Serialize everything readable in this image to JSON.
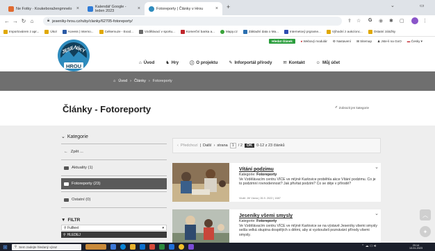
{
  "browser": {
    "tabs": [
      {
        "title": "Ne Fotky · Koukeboražengmnelo",
        "color": "#e06a2f"
      },
      {
        "title": "Kalendář Google - leden 2023",
        "color": "#2e7bd6"
      },
      {
        "title": "Fotoreporty | Články v Hrou",
        "color": "#2e8bbd"
      }
    ],
    "new_tab_label": "+",
    "url": "jeseniky-hrou.cz/ruby/clanky/62705-fotoreporty/",
    "bookmarks": [
      {
        "label": "Importovárem z apr...",
        "color": "#e0a800"
      },
      {
        "label": "Úkol",
        "color": "#e0a800"
      },
      {
        "label": "Aceess | Interno...",
        "color": "#2b5aa5"
      },
      {
        "label": "Celkemuze - Exod...",
        "color": "#e0a800"
      },
      {
        "label": "Vzdělávací v sportu...",
        "color": "#6a6a6a"
      },
      {
        "label": "Komerční banka a...",
        "color": "#c0262b"
      },
      {
        "label": "Mapy.cz",
        "color": "#3aa33a"
      },
      {
        "label": "Základní data o Ma...",
        "color": "#2b6fb0"
      },
      {
        "label": "Internetový prgrame...",
        "color": "#2d4db0"
      },
      {
        "label": "Výhodní z aukcíonc...",
        "color": "#e0a800"
      },
      {
        "label": "Ostatní záložky",
        "color": "#e0a800"
      }
    ]
  },
  "site": {
    "top_links": {
      "hledat": "Hledat článek",
      "ekniha": "Webový modulár",
      "nastaveni": "Nastavení",
      "sitemap": "Sitemap",
      "login": "Jste-li na GoO",
      "lang": "Česky"
    },
    "logo_text": {
      "line1": "JESE",
      "line2": "NÍKY",
      "line3": "HROU"
    },
    "nav": [
      {
        "icon": "home-icon",
        "label": "Úvod"
      },
      {
        "icon": "game-icon",
        "label": "Hry"
      },
      {
        "icon": "info-icon",
        "label": "O projektu"
      },
      {
        "icon": "leaf-icon",
        "label": "Inforportál přírody"
      },
      {
        "icon": "mail-icon",
        "label": "Kontakt"
      },
      {
        "icon": "user-icon",
        "label": "Můj účet"
      }
    ],
    "breadcrumb": [
      "Úvod",
      "Články",
      "Fotoreporty"
    ],
    "page_title": "Články - Fotoreporty",
    "shortlink": "Zobrazit jen kategorie"
  },
  "sidebar": {
    "heading": "Kategorie",
    "back": "Zpět ...",
    "items": [
      {
        "label": "Aktuality (1)",
        "active": false
      },
      {
        "label": "Fotoreporty (23)",
        "active": true
      },
      {
        "label": "Ostatní (0)",
        "active": false
      }
    ],
    "filter_heading": "FILTR",
    "fulltext_label": "Fulltext",
    "search_button": "HLEDEJ"
  },
  "pager": {
    "prev": "Předchozí",
    "next": "Další",
    "page_word": "strana",
    "page": "1",
    "of": "/ 2",
    "go": "OK",
    "range": "0-12 z 23 článků"
  },
  "articles": [
    {
      "title": "Vítání podzimu",
      "category_label": "Kategorie:",
      "category": "Fotoreporty",
      "description": "Ve Vzdělávacím centru VÍCE ve mlýně Karlovice proběhla akce Vítání podzimu. Co je to podzimní rovnodennost? Jak přivítat podzim? Co se děje v přírodě?",
      "meta": "Vložil: Jiří Vávra | 26.9. 2022 | 1687"
    },
    {
      "title": "Jeseníky všemi smysly",
      "category_label": "Kategorie:",
      "category": "Fotoreporty",
      "description": "Ve Vzdělávacím centru VÍCE ve mlýně Karlovice se na výstavě Jeseníky všemi smysly sešla velká skupina dospělých s dětmi, aby si vyzkoušeli poznávání přírody všemi smysly.",
      "meta": ""
    }
  ],
  "taskbar": {
    "search_placeholder": "Sem zadejte hledaný výraz",
    "time": "20:14",
    "date": "13.01.2023"
  },
  "colors": {
    "brand_blue": "#2e8bbd",
    "logo_dark": "#123f5a",
    "crumb_bar": "#6f6f6f",
    "active_item": "#5a5a5a",
    "green_button": "#2a9d3c"
  }
}
